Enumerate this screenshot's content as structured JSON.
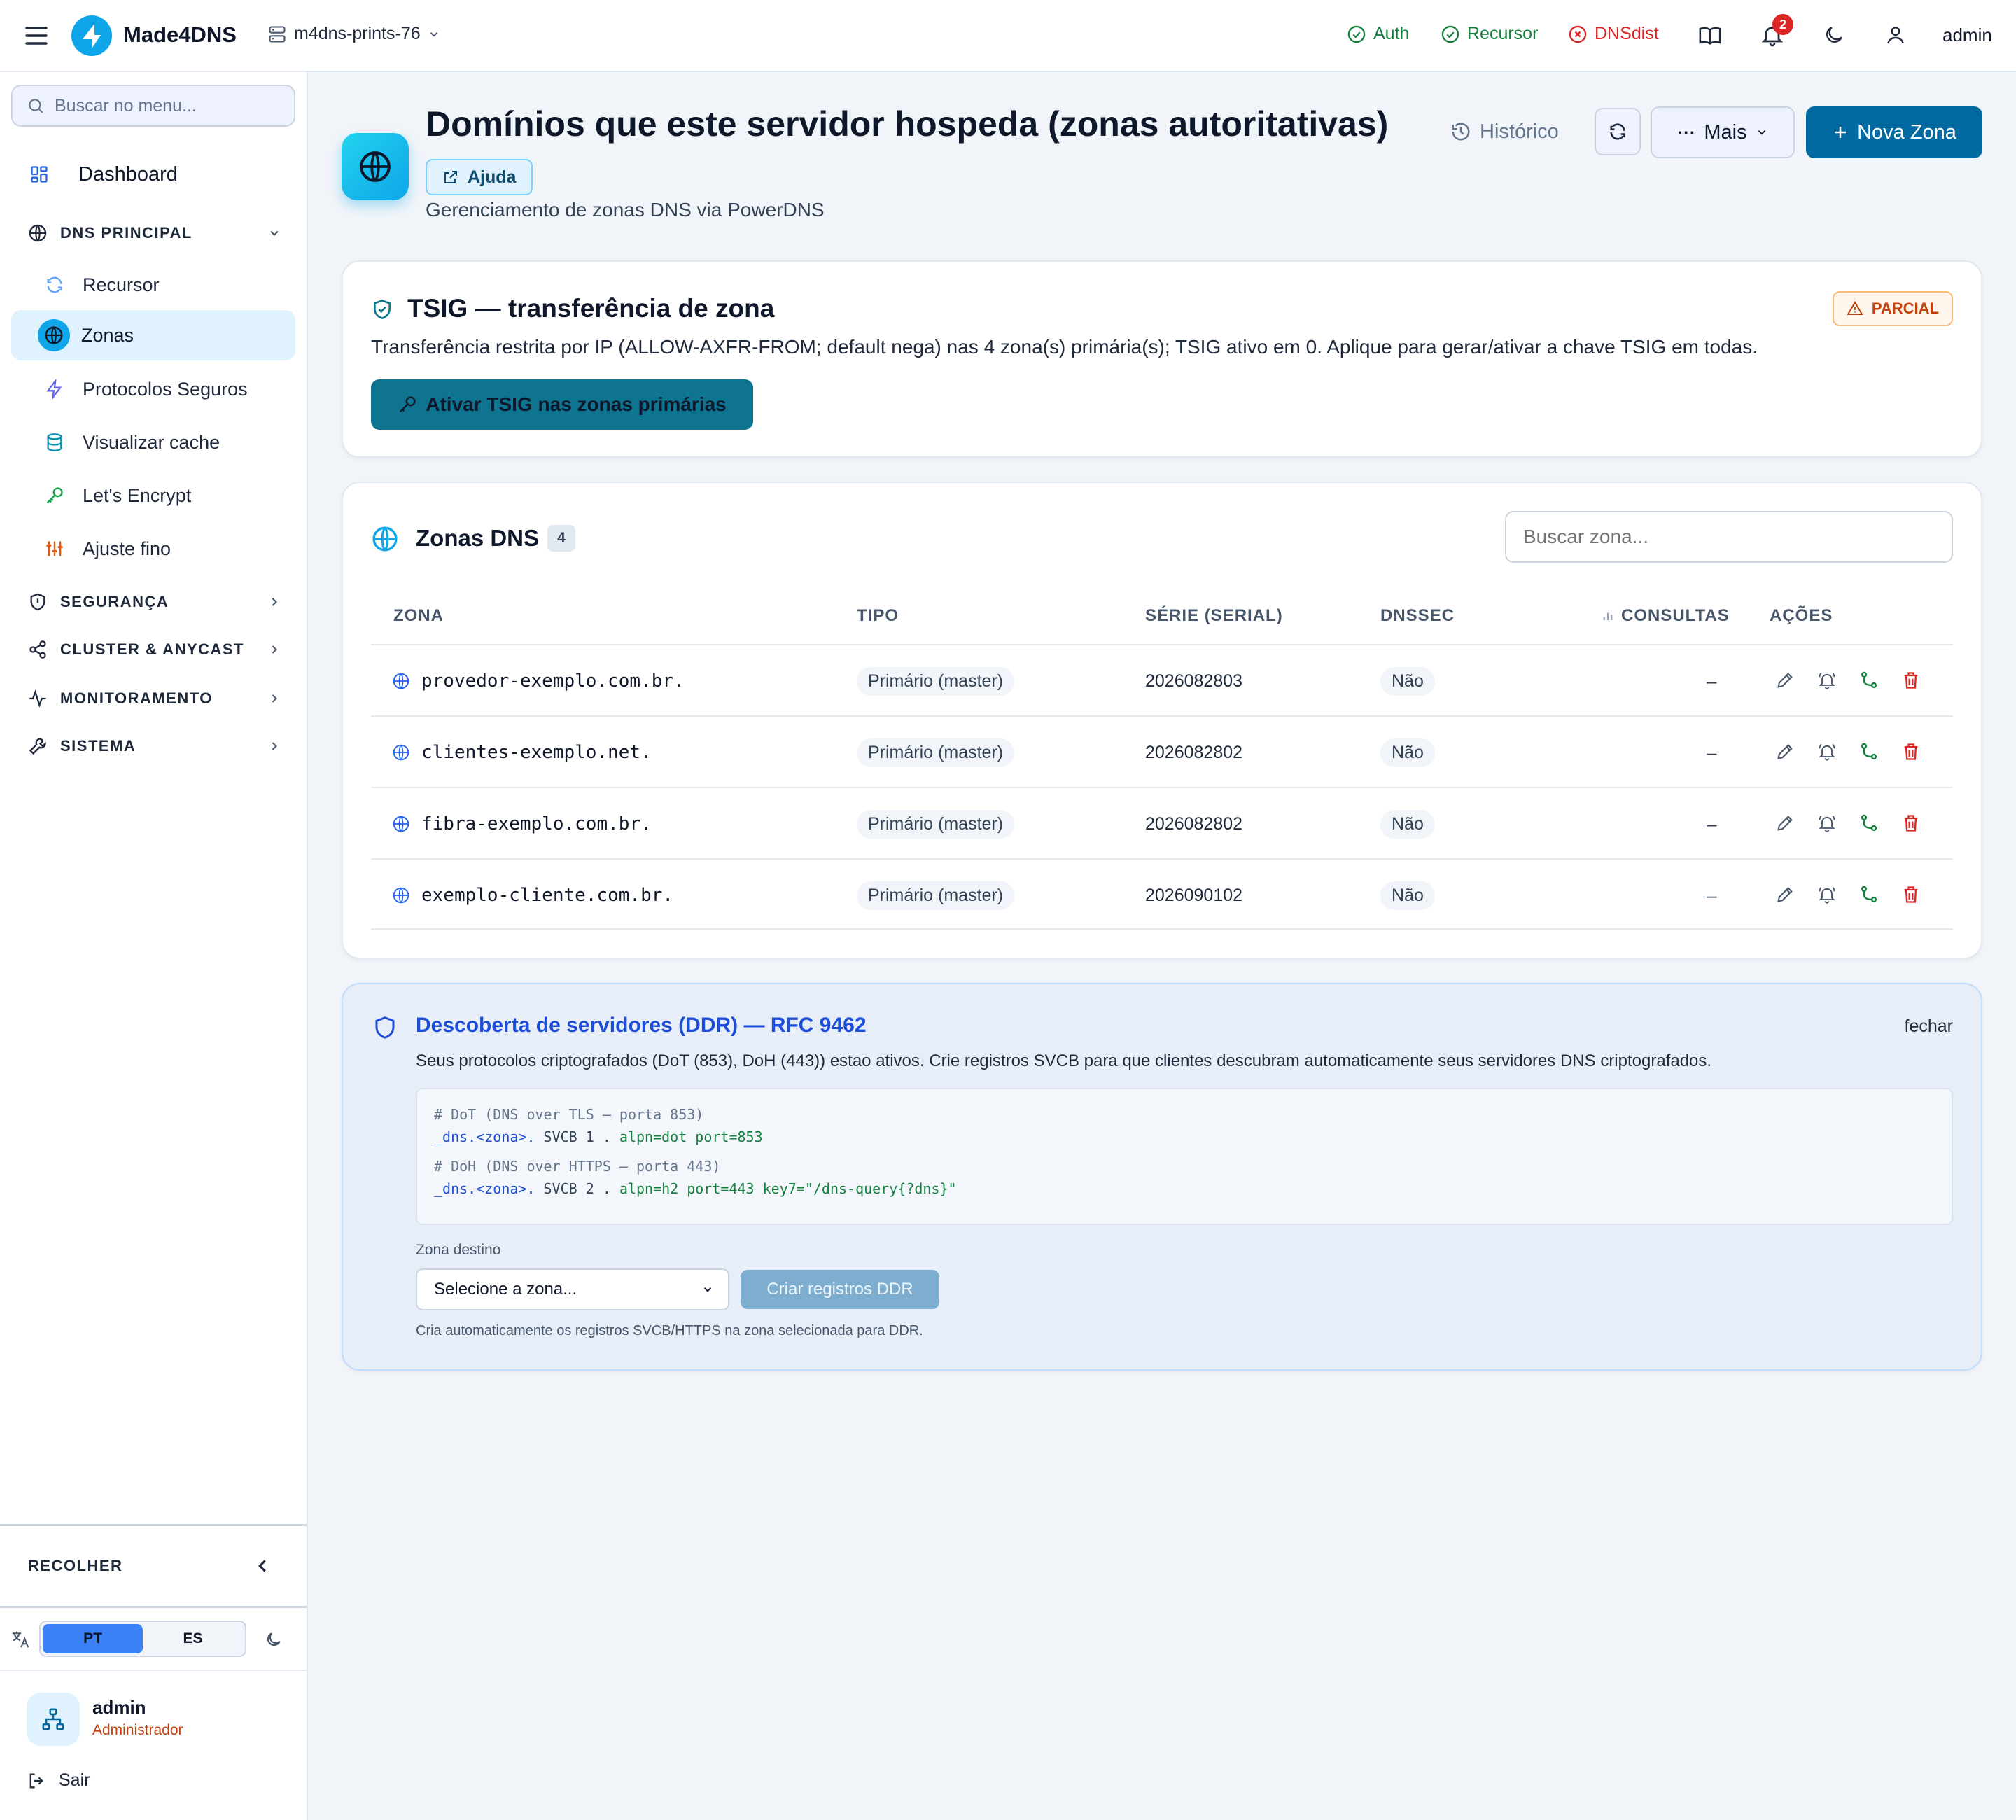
{
  "topbar": {
    "brand": "Made4DNS",
    "server": "m4dns-prints-76",
    "status": [
      {
        "label": "Auth",
        "state": "ok"
      },
      {
        "label": "Recursor",
        "state": "ok"
      },
      {
        "label": "DNSdist",
        "state": "error"
      }
    ],
    "notifications_count": "2",
    "user": "admin"
  },
  "sidebar": {
    "search_placeholder": "Buscar no menu...",
    "dashboard": "Dashboard",
    "dns_section": "DNS PRINCIPAL",
    "dns_items": [
      "Recursor",
      "Zonas",
      "Protocolos Seguros",
      "Visualizar cache",
      "Let's Encrypt",
      "Ajuste fino"
    ],
    "active_item": "Zonas",
    "sections": [
      "SEGURANÇA",
      "CLUSTER & ANYCAST",
      "MONITORAMENTO",
      "SISTEMA"
    ],
    "collapse": "RECOLHER",
    "languages": [
      "PT",
      "ES"
    ],
    "active_language": "PT",
    "user_name": "admin",
    "user_role": "Administrador",
    "logout": "Sair"
  },
  "header": {
    "title": "Domínios que este servidor hospeda (zonas autoritativas)",
    "help": "Ajuda",
    "subtitle": "Gerenciamento de zonas DNS via PowerDNS",
    "history": "Histórico",
    "more": "Mais",
    "new_zone": "Nova Zona"
  },
  "tsig": {
    "title": "TSIG — transferência de zona",
    "badge": "PARCIAL",
    "description": "Transferência restrita por IP (ALLOW-AXFR-FROM; default nega) nas 4 zona(s) primária(s); TSIG ativo em 0. Aplique para gerar/ativar a chave TSIG em todas.",
    "button": "Ativar TSIG nas zonas primárias"
  },
  "zones": {
    "title": "Zonas DNS",
    "count": "4",
    "search_placeholder": "Buscar zona...",
    "columns": {
      "zone": "ZONA",
      "type": "TIPO",
      "serial": "SÉRIE (SERIAL)",
      "dnssec": "DNSSEC",
      "queries": "CONSULTAS",
      "actions": "AÇÕES"
    },
    "rows": [
      {
        "zone": "provedor-exemplo.com.br.",
        "type": "Primário (master)",
        "serial": "2026082803",
        "dnssec": "Não",
        "queries": "–"
      },
      {
        "zone": "clientes-exemplo.net.",
        "type": "Primário (master)",
        "serial": "2026082802",
        "dnssec": "Não",
        "queries": "–"
      },
      {
        "zone": "fibra-exemplo.com.br.",
        "type": "Primário (master)",
        "serial": "2026082802",
        "dnssec": "Não",
        "queries": "–"
      },
      {
        "zone": "exemplo-cliente.com.br.",
        "type": "Primário (master)",
        "serial": "2026090102",
        "dnssec": "Não",
        "queries": "–"
      }
    ]
  },
  "ddr": {
    "title": "Descoberta de servidores (DDR) — RFC 9462",
    "close": "fechar",
    "description": "Seus protocolos criptografados (DoT (853), DoH (443)) estao ativos. Crie registros SVCB para que clientes descubram automaticamente seus servidores DNS criptografados.",
    "code": {
      "c1": "# DoT (DNS over TLS — porta 853)",
      "r1_name": "_dns.<zona>.",
      "r1_mid": " SVCB 1 . ",
      "r1_val": "alpn=dot port=853",
      "c2": "# DoH (DNS over HTTPS — porta 443)",
      "r2_name": "_dns.<zona>.",
      "r2_mid": " SVCB 2 . ",
      "r2_val": "alpn=h2 port=443 key7=\"/dns-query{?dns}\""
    },
    "target_label": "Zona destino",
    "select_placeholder": "Selecione a zona...",
    "create_button": "Criar registros DDR",
    "hint": "Cria automaticamente os registros SVCB/HTTPS na zona selecionada para DDR."
  },
  "colors": {
    "accent": "#0e7490",
    "primary_button": "#0369a1",
    "ok": "#15803d",
    "error": "#dc2626",
    "warning": "#c2410c"
  }
}
